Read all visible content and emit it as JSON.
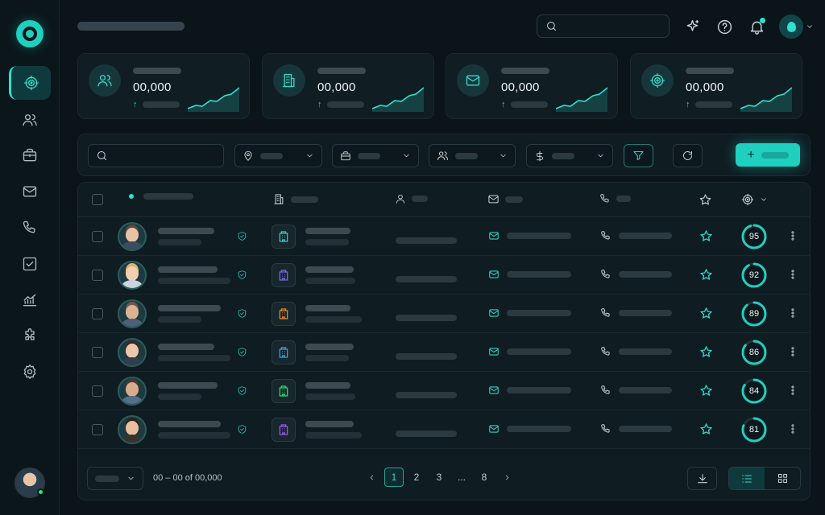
{
  "colors": {
    "accent": "#2ee0cf",
    "background": "#0a1419",
    "card": "#101d23",
    "positive": "#2ee07a"
  },
  "sidebar": {
    "items": [
      {
        "name": "sidebar-item-targets",
        "icon": "target-icon",
        "active": true
      },
      {
        "name": "sidebar-item-contacts",
        "icon": "users-icon",
        "active": false
      },
      {
        "name": "sidebar-item-companies",
        "icon": "briefcase-icon",
        "active": false
      },
      {
        "name": "sidebar-item-inbox",
        "icon": "mail-icon",
        "active": false
      },
      {
        "name": "sidebar-item-calls",
        "icon": "phone-icon",
        "active": false
      },
      {
        "name": "sidebar-item-tasks",
        "icon": "checkbox-icon",
        "active": false
      },
      {
        "name": "sidebar-item-reports",
        "icon": "chart-icon",
        "active": false
      },
      {
        "name": "sidebar-item-integrations",
        "icon": "puzzle-icon",
        "active": false
      },
      {
        "name": "sidebar-item-settings",
        "icon": "gear-icon",
        "active": false
      }
    ]
  },
  "header": {
    "search_placeholder": "",
    "icons": [
      "sparkle-icon",
      "help-icon",
      "bell-icon"
    ]
  },
  "stats": [
    {
      "icon": "users-icon",
      "value": "00,000"
    },
    {
      "icon": "building-icon",
      "value": "00,000"
    },
    {
      "icon": "mail-icon",
      "value": "00,000"
    },
    {
      "icon": "target-icon",
      "value": "00,000"
    }
  ],
  "filters": {
    "search_placeholder": "",
    "icons": [
      "location-icon",
      "briefcase-icon",
      "users-icon",
      "dollar-icon"
    ]
  },
  "table": {
    "columns": [
      "name-column",
      "company-column",
      "contact-column",
      "email-column",
      "phone-column",
      "favorite-column",
      "score-column"
    ],
    "rows": [
      {
        "score": 95,
        "company_color": "#2ed6c6",
        "skin": "#e6c3a3",
        "hair": "#5a4a3e",
        "shirt": "#3a4c5e"
      },
      {
        "score": 92,
        "company_color": "#7b6cf0",
        "skin": "#f0cfb2",
        "hair": "#d9b26a",
        "shirt": "#c9d6df"
      },
      {
        "score": 89,
        "company_color": "#f08a2a",
        "skin": "#dcb294",
        "hair": "#6e5a4a",
        "shirt": "#4d6177"
      },
      {
        "score": 86,
        "company_color": "#3aa6e8",
        "skin": "#ecc7aa",
        "hair": "#3a2a22",
        "shirt": "#2d3f4f"
      },
      {
        "score": 84,
        "company_color": "#2ee07a",
        "skin": "#d8ad8e",
        "hair": "#4b3a30",
        "shirt": "#56708a"
      },
      {
        "score": 81,
        "company_color": "#a05af0",
        "skin": "#e8c0a0",
        "hair": "#2e211b",
        "shirt": "#37332f"
      }
    ]
  },
  "footer": {
    "range_text": "00 – 00 of 00,000",
    "pages": [
      "1",
      "2",
      "3",
      "...",
      "8"
    ],
    "current_page": "1"
  }
}
